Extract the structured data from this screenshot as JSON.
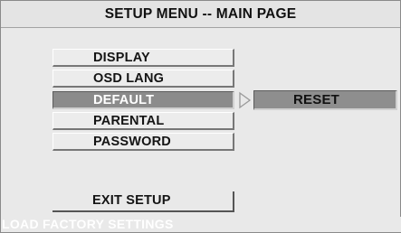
{
  "header": {
    "title": "SETUP MENU -- MAIN PAGE"
  },
  "menu": {
    "items": [
      {
        "label": "DISPLAY"
      },
      {
        "label": "OSD LANG"
      },
      {
        "label": "DEFAULT"
      },
      {
        "label": "PARENTAL"
      },
      {
        "label": "PASSWORD"
      }
    ],
    "selected": "DEFAULT"
  },
  "submenu": {
    "label": "RESET",
    "arrow_icon": "triangle-right-outline-icon"
  },
  "exit": {
    "label": "EXIT SETUP"
  },
  "status": {
    "text": "LOAD FACTORY SETTINGS"
  },
  "colors": {
    "background": "#e9e9e9",
    "selected": "#8b8b8b",
    "status_text": "#ffffff"
  }
}
